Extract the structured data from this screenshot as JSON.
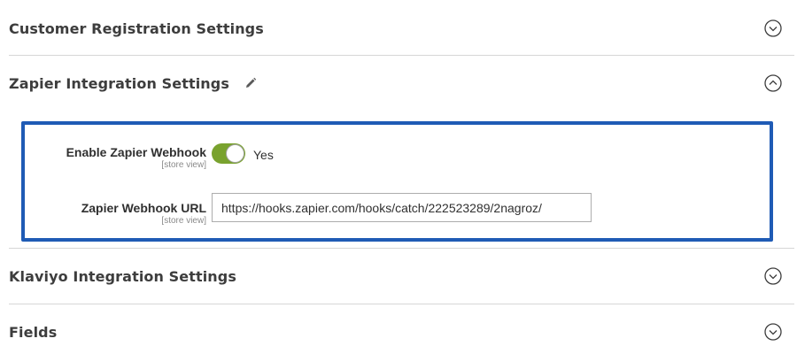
{
  "sections": {
    "customer_registration": {
      "title": "Customer Registration Settings",
      "state": "collapsed",
      "icon": "chevron-down-icon"
    },
    "zapier": {
      "title": "Zapier Integration Settings",
      "state": "expanded",
      "icon": "chevron-up-icon",
      "edit_icon": "pencil-icon"
    },
    "klaviyo": {
      "title": "Klaviyo Integration Settings",
      "state": "collapsed",
      "icon": "chevron-down-icon"
    },
    "fields": {
      "title": "Fields",
      "state": "collapsed",
      "icon": "chevron-down-icon"
    }
  },
  "zapier_form": {
    "enable_webhook": {
      "label": "Enable Zapier Webhook",
      "scope": "[store view]",
      "value": "Yes",
      "enabled": true
    },
    "webhook_url": {
      "label": "Zapier Webhook URL",
      "scope": "[store view]",
      "value": "https://hooks.zapier.com/hooks/catch/222523289/2nagroz/"
    }
  },
  "colors": {
    "panel_border": "#1f5bb5",
    "toggle_on": "#79a22e",
    "divider": "#d6d6d6",
    "title_text": "#3d3d3d"
  }
}
